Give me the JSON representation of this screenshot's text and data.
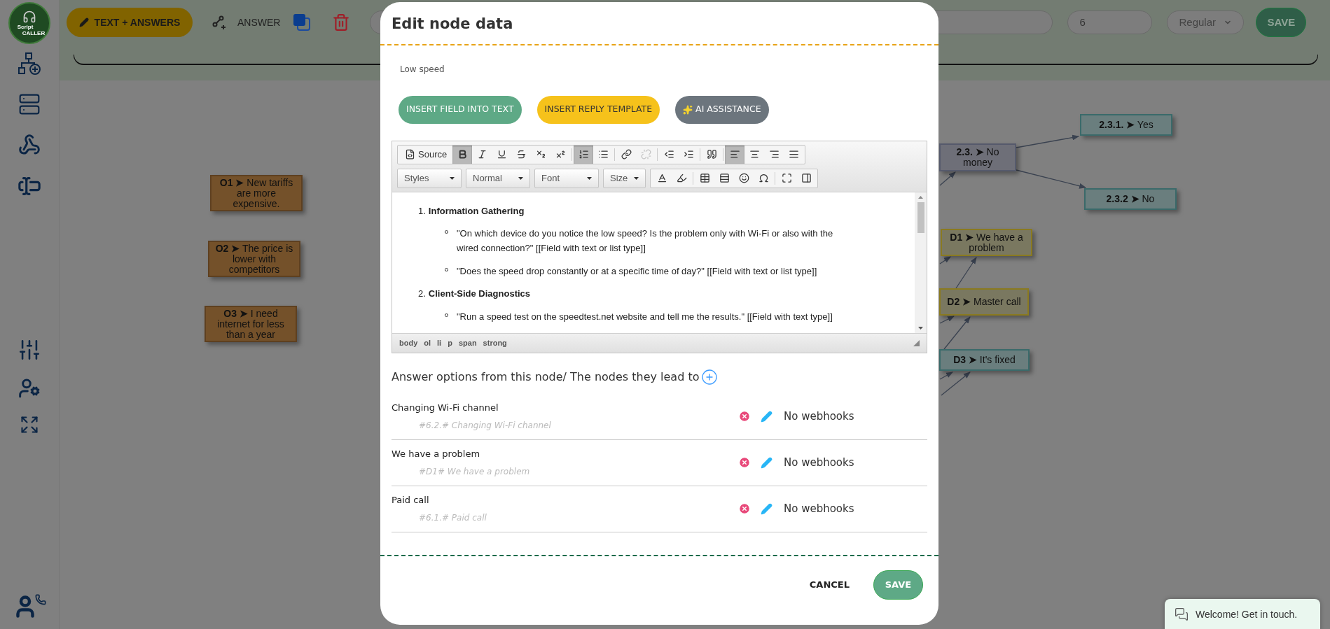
{
  "logo": {
    "line_1": "Script",
    "line_2": "CALLER"
  },
  "toolbar": {
    "text_answers_button": "TEXT + ANSWERS",
    "answer_button": "ANSWER",
    "number_field": "6",
    "style_select": "Regular",
    "save_button": "SAVE"
  },
  "nodes": [
    {
      "kind": "objection",
      "label": "**O1 ➤** New tariffs are more expensive."
    },
    {
      "kind": "objection",
      "label": "**O2 ➤** The price is lower with competitors"
    },
    {
      "kind": "objection",
      "label": "**O3 ➤** I need internet for less than a year"
    },
    {
      "kind": "branch",
      "label": "**2.3. ➤** No money"
    },
    {
      "kind": "answer",
      "label": "**2.3.1. ➤** Yes"
    },
    {
      "kind": "answer",
      "label": "**2.3.2 ➤** No"
    },
    {
      "kind": "outcome",
      "label": "**D1 ➤** We have a problem"
    },
    {
      "kind": "outcome",
      "label": "**D2 ➤** Master call"
    },
    {
      "kind": "answer",
      "label": "**D3 ➤** It's fixed"
    }
  ],
  "modal": {
    "title": "Edit node data",
    "node_name": "Low speed",
    "action_buttons": [
      {
        "kind": "insert_field",
        "label": "INSERT FIELD INTO TEXT"
      },
      {
        "kind": "reply_template",
        "label": "INSERT REPLY TEMPLATE"
      },
      {
        "kind": "ai",
        "label": "AI ASSISTANCE"
      }
    ],
    "editor": {
      "toolbar_row_1": [
        [
          {
            "kind": "source",
            "label": "Source",
            "pressed": false,
            "disabled": false
          },
          {
            "kind": "bold",
            "pressed": true,
            "disabled": false
          },
          {
            "kind": "italic",
            "pressed": false,
            "disabled": false
          },
          {
            "kind": "underline",
            "pressed": false,
            "disabled": false
          },
          {
            "kind": "strike",
            "pressed": false,
            "disabled": false
          },
          {
            "kind": "subscript",
            "pressed": false,
            "disabled": false
          },
          {
            "kind": "superscript",
            "pressed": false,
            "disabled": false
          }
        ],
        [
          {
            "kind": "ordered_list",
            "pressed": true,
            "disabled": false
          },
          {
            "kind": "bullet_list",
            "pressed": false,
            "disabled": false
          }
        ],
        [
          {
            "kind": "link",
            "pressed": false,
            "disabled": false
          },
          {
            "kind": "unlink",
            "pressed": false,
            "disabled": true
          }
        ],
        [
          {
            "kind": "outdent",
            "pressed": false,
            "disabled": false
          },
          {
            "kind": "indent",
            "pressed": false,
            "disabled": false
          }
        ],
        [
          {
            "kind": "quote",
            "pressed": false,
            "disabled": false
          }
        ],
        [
          {
            "kind": "align_left",
            "pressed": true,
            "disabled": false
          },
          {
            "kind": "align_center",
            "pressed": false,
            "disabled": false
          },
          {
            "kind": "align_right",
            "pressed": false,
            "disabled": false
          },
          {
            "kind": "justify",
            "pressed": false,
            "disabled": false
          }
        ]
      ],
      "dropdowns": [
        "Styles",
        "Normal",
        "Font",
        "Size"
      ],
      "toolbar_row_2": [
        [
          {
            "kind": "text_color"
          },
          {
            "kind": "bg_color"
          }
        ],
        [
          {
            "kind": "table"
          },
          {
            "kind": "horizontal_line"
          },
          {
            "kind": "smiley"
          },
          {
            "kind": "special_char"
          }
        ],
        [
          {
            "kind": "maximize"
          },
          {
            "kind": "show_blocks"
          }
        ]
      ],
      "content": [
        {
          "number": "1.",
          "heading": "Information Gathering",
          "items": [
            "\"On which device do you notice the low speed? Is the problem only with Wi-Fi or also with the wired connection?\" [[Field with text or list type]]",
            "\"Does the speed drop constantly or at a specific time of day?\" [[Field with text or list type]]"
          ]
        },
        {
          "number": "2.",
          "heading": "Client-Side Diagnostics",
          "items": [
            "\"Run a speed test on the speedtest.net website and tell me the results.\" [[Field with text type]]"
          ]
        }
      ],
      "path": [
        "body",
        "ol",
        "li",
        "p",
        "span",
        "strong"
      ]
    },
    "answers_heading": "Answer options from this node/ The nodes they lead to",
    "answers": [
      {
        "title": "Changing Wi-Fi channel",
        "target": "#6.2.# Changing Wi-Fi channel",
        "webhooks": "No webhooks"
      },
      {
        "title": "We have a problem",
        "target": "#D1# We have a problem",
        "webhooks": "No webhooks"
      },
      {
        "title": "Paid call",
        "target": "#6.1.# Paid call",
        "webhooks": "No webhooks"
      }
    ],
    "cancel_button": "CANCEL",
    "save_button": "SAVE"
  },
  "chat_widget": {
    "text": "Welcome! Get in touch."
  }
}
